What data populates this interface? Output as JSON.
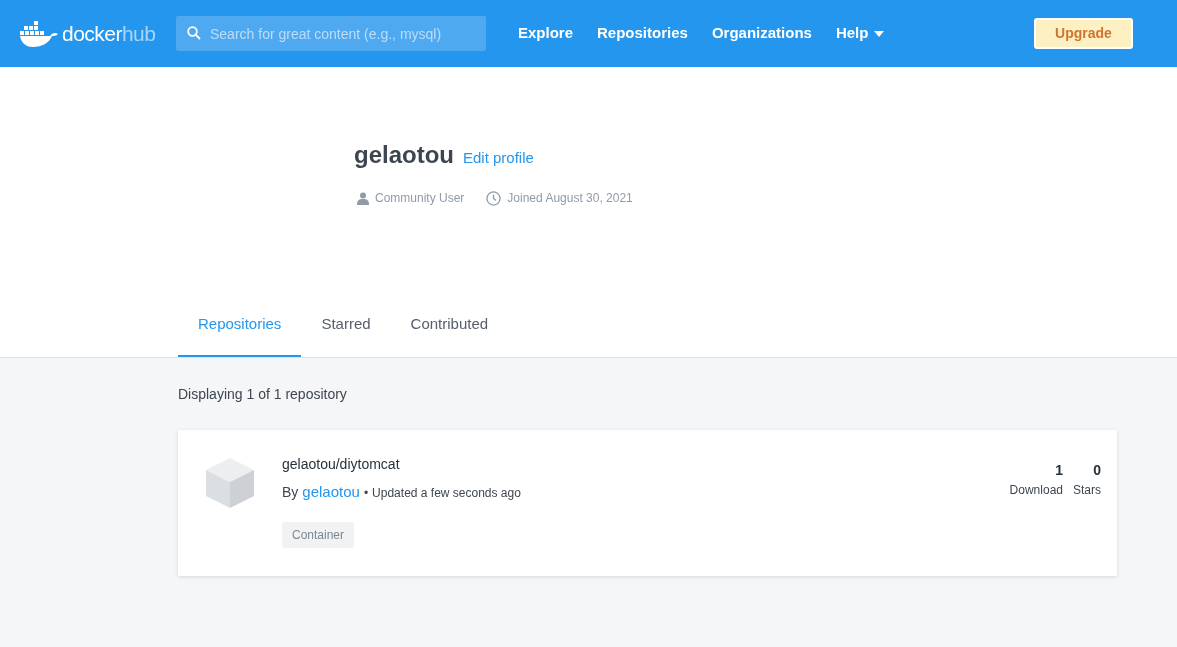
{
  "header": {
    "logo": {
      "word_1": "docker",
      "word_2": "hub"
    },
    "search": {
      "placeholder": "Search for great content (e.g., mysql)"
    },
    "nav": [
      {
        "label": "Explore",
        "dropdown": false
      },
      {
        "label": "Repositories",
        "dropdown": false
      },
      {
        "label": "Organizations",
        "dropdown": false
      },
      {
        "label": "Help",
        "dropdown": true
      }
    ],
    "upgrade_button": "Upgrade"
  },
  "profile": {
    "username": "gelaotou",
    "edit_link": "Edit profile",
    "meta": [
      {
        "kind": "user",
        "text": "Community User"
      },
      {
        "kind": "clock",
        "text": "Joined August 30, 2021"
      }
    ]
  },
  "tabs": [
    {
      "label": "Repositories",
      "selected": true
    },
    {
      "label": "Starred",
      "selected": false
    },
    {
      "label": "Contributed",
      "selected": false
    }
  ],
  "summary": "Displaying 1 of 1 repository",
  "repositories": [
    {
      "name": "gelaotou/diytomcat",
      "by_label": "By",
      "owner": "gelaotou",
      "separator": "•",
      "updated": "Updated a few seconds ago",
      "tag": "Container",
      "stats": [
        {
          "value": "1",
          "label": "Download"
        },
        {
          "value": "0",
          "label": "Stars"
        }
      ]
    }
  ]
}
